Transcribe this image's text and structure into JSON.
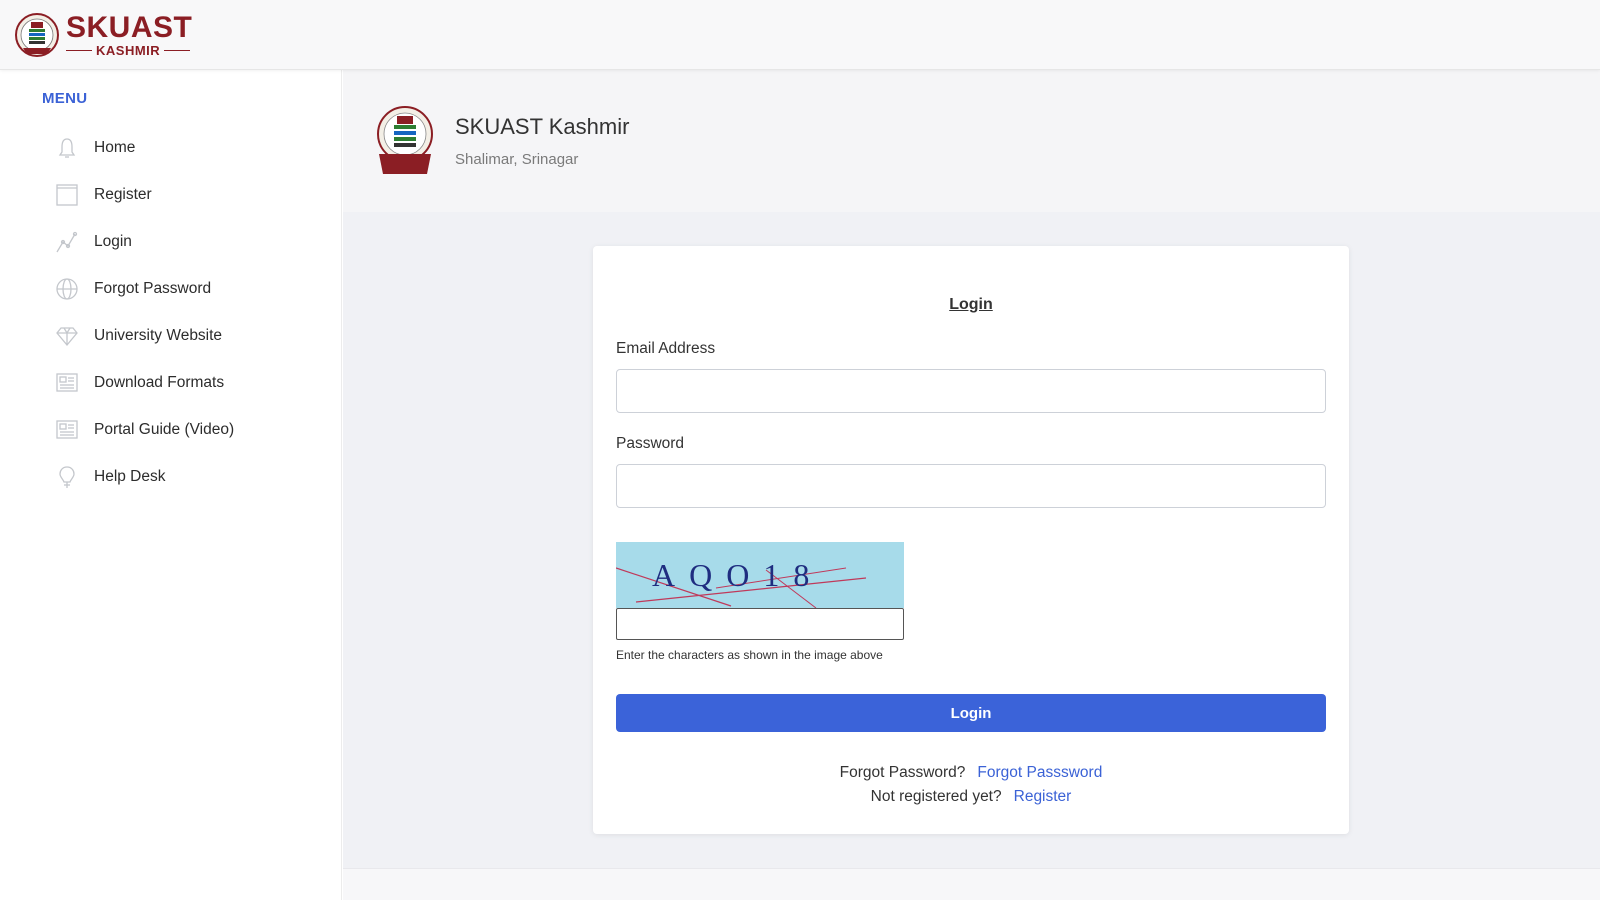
{
  "brand": {
    "name": "SKUAST",
    "subname": "KASHMIR"
  },
  "sidebar": {
    "heading": "MENU",
    "items": [
      {
        "label": "Home",
        "icon": "bell-icon"
      },
      {
        "label": "Register",
        "icon": "square-icon"
      },
      {
        "label": "Login",
        "icon": "graph-icon"
      },
      {
        "label": "Forgot Password",
        "icon": "globe-icon"
      },
      {
        "label": "University Website",
        "icon": "diamond-icon"
      },
      {
        "label": "Download Formats",
        "icon": "document-icon"
      },
      {
        "label": "Portal Guide (Video)",
        "icon": "document-icon"
      },
      {
        "label": "Help Desk",
        "icon": "lightbulb-icon"
      }
    ]
  },
  "header": {
    "title": "SKUAST Kashmir",
    "subtitle": "Shalimar, Srinagar"
  },
  "login": {
    "title": "Login",
    "email_label": "Email Address",
    "email_value": "",
    "password_label": "Password",
    "password_value": "",
    "captcha_text": "AQO18",
    "captcha_value": "",
    "captcha_hint": "Enter the characters as shown in the image above",
    "button_label": "Login",
    "forgot_prompt": "Forgot Password?",
    "forgot_link": "Forgot Passsword",
    "register_prompt": "Not registered yet?",
    "register_link": "Register"
  },
  "colors": {
    "accent": "#3b63d9",
    "brand": "#8b1e24",
    "captcha_bg": "#a7dbea"
  }
}
